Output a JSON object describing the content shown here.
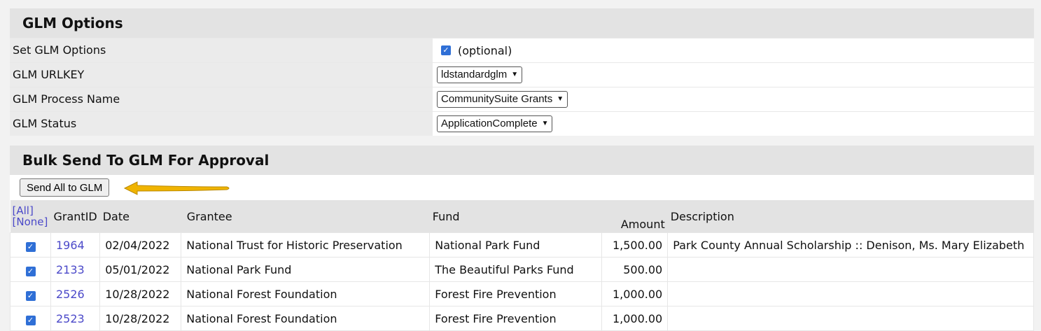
{
  "glm_options": {
    "title": "GLM Options",
    "rows": [
      {
        "label": "Set GLM Options",
        "type": "checkbox",
        "checked": true,
        "value": "(optional)"
      },
      {
        "label": "GLM URLKEY",
        "type": "select",
        "value": "ldstandardglm"
      },
      {
        "label": "GLM Process Name",
        "type": "select",
        "value": "CommunitySuite Grants"
      },
      {
        "label": "GLM Status",
        "type": "select",
        "value": "ApplicationComplete"
      }
    ]
  },
  "bulk": {
    "title": "Bulk Send To GLM For Approval",
    "send_button": "Send All to GLM",
    "arrow_color": "#f0b400",
    "select_all": "[All]",
    "select_none": "[None]",
    "columns": [
      "GrantID",
      "Date",
      "Grantee",
      "Fund",
      "Amount",
      "Description"
    ],
    "rows": [
      {
        "checked": true,
        "grant_id": "1964",
        "date": "02/04/2022",
        "grantee": "National Trust for Historic Preservation",
        "fund": "National Park Fund",
        "amount": "1,500.00",
        "description": "Park County Annual Scholarship :: Denison, Ms. Mary Elizabeth"
      },
      {
        "checked": true,
        "grant_id": "2133",
        "date": "05/01/2022",
        "grantee": "National Park Fund",
        "fund": "The Beautiful Parks Fund",
        "amount": "500.00",
        "description": ""
      },
      {
        "checked": true,
        "grant_id": "2526",
        "date": "10/28/2022",
        "grantee": "National Forest Foundation",
        "fund": "Forest Fire Prevention",
        "amount": "1,000.00",
        "description": ""
      },
      {
        "checked": true,
        "grant_id": "2523",
        "date": "10/28/2022",
        "grantee": "National Forest Foundation",
        "fund": "Forest Fire Prevention",
        "amount": "1,000.00",
        "description": ""
      }
    ]
  }
}
